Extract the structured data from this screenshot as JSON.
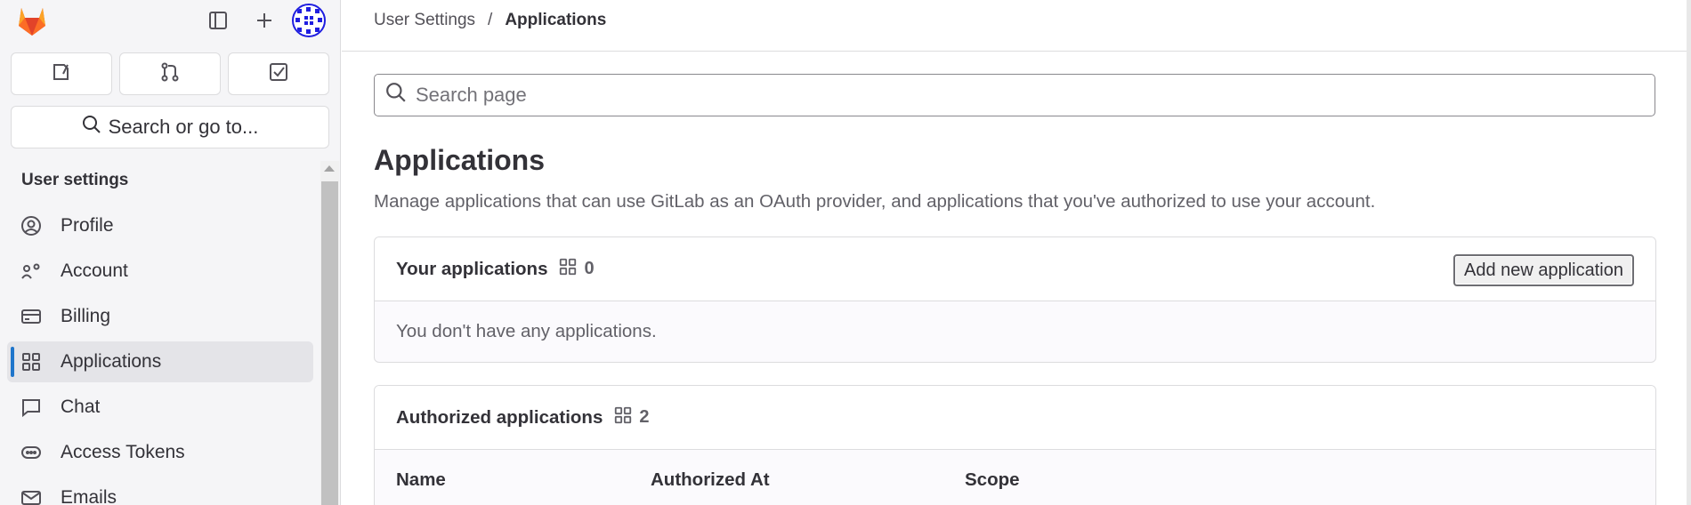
{
  "sidebar": {
    "search_label": "Search or go to...",
    "heading": "User settings",
    "items": [
      {
        "label": "Profile",
        "icon": "profile-icon"
      },
      {
        "label": "Account",
        "icon": "account-icon"
      },
      {
        "label": "Billing",
        "icon": "billing-icon"
      },
      {
        "label": "Applications",
        "icon": "applications-icon",
        "active": true
      },
      {
        "label": "Chat",
        "icon": "chat-icon"
      },
      {
        "label": "Access Tokens",
        "icon": "token-icon"
      },
      {
        "label": "Emails",
        "icon": "email-icon"
      }
    ],
    "quick_actions": [
      "issues-icon",
      "merge-requests-icon",
      "todo-icon"
    ]
  },
  "breadcrumb": {
    "parent": "User Settings",
    "separator": "/",
    "current": "Applications"
  },
  "search": {
    "placeholder": "Search page"
  },
  "page": {
    "title": "Applications",
    "description": "Manage applications that can use GitLab as an OAuth provider, and applications that you've authorized to use your account."
  },
  "your_apps": {
    "title": "Your applications",
    "count": "0",
    "add_button": "Add new application",
    "empty_text": "You don't have any applications."
  },
  "authorized_apps": {
    "title": "Authorized applications",
    "count": "2",
    "columns": [
      "Name",
      "Authorized At",
      "Scope"
    ]
  },
  "colors": {
    "accent": "#1f75cb",
    "logo": "#fc6d26"
  }
}
